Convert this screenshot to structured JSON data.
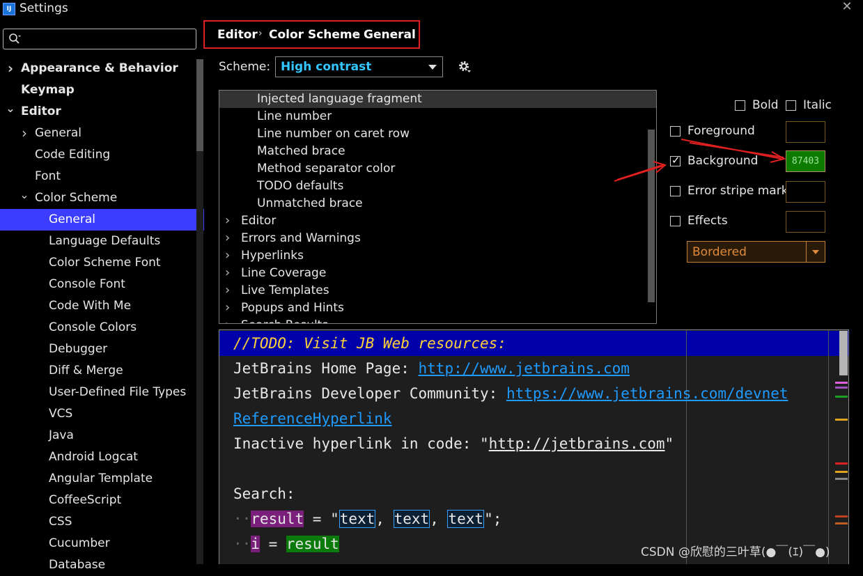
{
  "window": {
    "title": "Settings",
    "app_icon_text": "IJ"
  },
  "search": {
    "placeholder": ""
  },
  "sidebar": {
    "items": [
      {
        "label": "Appearance & Behavior",
        "bold": true,
        "chevron": "right",
        "indent": 0
      },
      {
        "label": "Keymap",
        "bold": true,
        "chevron": "",
        "indent": 0
      },
      {
        "label": "Editor",
        "bold": true,
        "chevron": "down",
        "indent": 0
      },
      {
        "label": "General",
        "bold": false,
        "chevron": "right",
        "indent": 1
      },
      {
        "label": "Code Editing",
        "bold": false,
        "chevron": "",
        "indent": 1
      },
      {
        "label": "Font",
        "bold": false,
        "chevron": "",
        "indent": 1
      },
      {
        "label": "Color Scheme",
        "bold": false,
        "chevron": "down",
        "indent": 1
      },
      {
        "label": "General",
        "bold": false,
        "chevron": "",
        "indent": 2,
        "selected": true
      },
      {
        "label": "Language Defaults",
        "bold": false,
        "chevron": "",
        "indent": 2
      },
      {
        "label": "Color Scheme Font",
        "bold": false,
        "chevron": "",
        "indent": 2
      },
      {
        "label": "Console Font",
        "bold": false,
        "chevron": "",
        "indent": 2
      },
      {
        "label": "Code With Me",
        "bold": false,
        "chevron": "",
        "indent": 2
      },
      {
        "label": "Console Colors",
        "bold": false,
        "chevron": "",
        "indent": 2
      },
      {
        "label": "Debugger",
        "bold": false,
        "chevron": "",
        "indent": 2
      },
      {
        "label": "Diff & Merge",
        "bold": false,
        "chevron": "",
        "indent": 2
      },
      {
        "label": "User-Defined File Types",
        "bold": false,
        "chevron": "",
        "indent": 2
      },
      {
        "label": "VCS",
        "bold": false,
        "chevron": "",
        "indent": 2
      },
      {
        "label": "Java",
        "bold": false,
        "chevron": "",
        "indent": 2
      },
      {
        "label": "Android Logcat",
        "bold": false,
        "chevron": "",
        "indent": 2
      },
      {
        "label": "Angular Template",
        "bold": false,
        "chevron": "",
        "indent": 2
      },
      {
        "label": "CoffeeScript",
        "bold": false,
        "chevron": "",
        "indent": 2
      },
      {
        "label": "CSS",
        "bold": false,
        "chevron": "",
        "indent": 2
      },
      {
        "label": "Cucumber",
        "bold": false,
        "chevron": "",
        "indent": 2
      },
      {
        "label": "Database",
        "bold": false,
        "chevron": "",
        "indent": 2
      }
    ]
  },
  "breadcrumb": {
    "items": [
      "Editor",
      "Color Scheme",
      "General"
    ]
  },
  "scheme": {
    "label": "Scheme:",
    "value": "High contrast"
  },
  "attributes_list": {
    "items": [
      {
        "label": "Injected language fragment",
        "group": false,
        "selected": true
      },
      {
        "label": "Line number",
        "group": false
      },
      {
        "label": "Line number on caret row",
        "group": false
      },
      {
        "label": "Matched brace",
        "group": false
      },
      {
        "label": "Method separator color",
        "group": false
      },
      {
        "label": "TODO defaults",
        "group": false
      },
      {
        "label": "Unmatched brace",
        "group": false
      },
      {
        "label": "Editor",
        "group": true
      },
      {
        "label": "Errors and Warnings",
        "group": true
      },
      {
        "label": "Hyperlinks",
        "group": true
      },
      {
        "label": "Line Coverage",
        "group": true
      },
      {
        "label": "Live Templates",
        "group": true
      },
      {
        "label": "Popups and Hints",
        "group": true
      },
      {
        "label": "Search Results",
        "group": true
      }
    ]
  },
  "options": {
    "bold_label": "Bold",
    "italic_label": "Italic",
    "foreground_label": "Foreground",
    "background_label": "Background",
    "background_color_text": "87403",
    "error_stripe_label": "Error stripe mark",
    "effects_label": "Effects",
    "effects_type": "Bordered"
  },
  "preview": {
    "todo": "//TODO: Visit JB Web resources:",
    "home_label": "JetBrains Home Page: ",
    "home_url": "http://www.jetbrains.com",
    "community_label": "JetBrains Developer Community: ",
    "community_url": "https://www.jetbrains.com/devnet",
    "ref_link": "ReferenceHyperlink",
    "inactive_label": "Inactive hyperlink in code: \"",
    "inactive_url": "http://jetbrains.com",
    "inactive_end": "\"",
    "search_label": "Search:",
    "result_var": "result",
    "assign": " = \"",
    "text_word": "text",
    "comma": ", ",
    "end_str": "\";",
    "i_var": "i",
    "assign2": " = ",
    "result2": "result"
  },
  "watermark": "CSDN @欣慰的三叶草(●￣(ｴ)￣●)",
  "colors": {
    "accent_selection": "#3d3dff",
    "scheme_value": "#33c6ff",
    "annotation_red": "#e02020",
    "todo": "#ffd23a",
    "link": "#1e9bff"
  }
}
